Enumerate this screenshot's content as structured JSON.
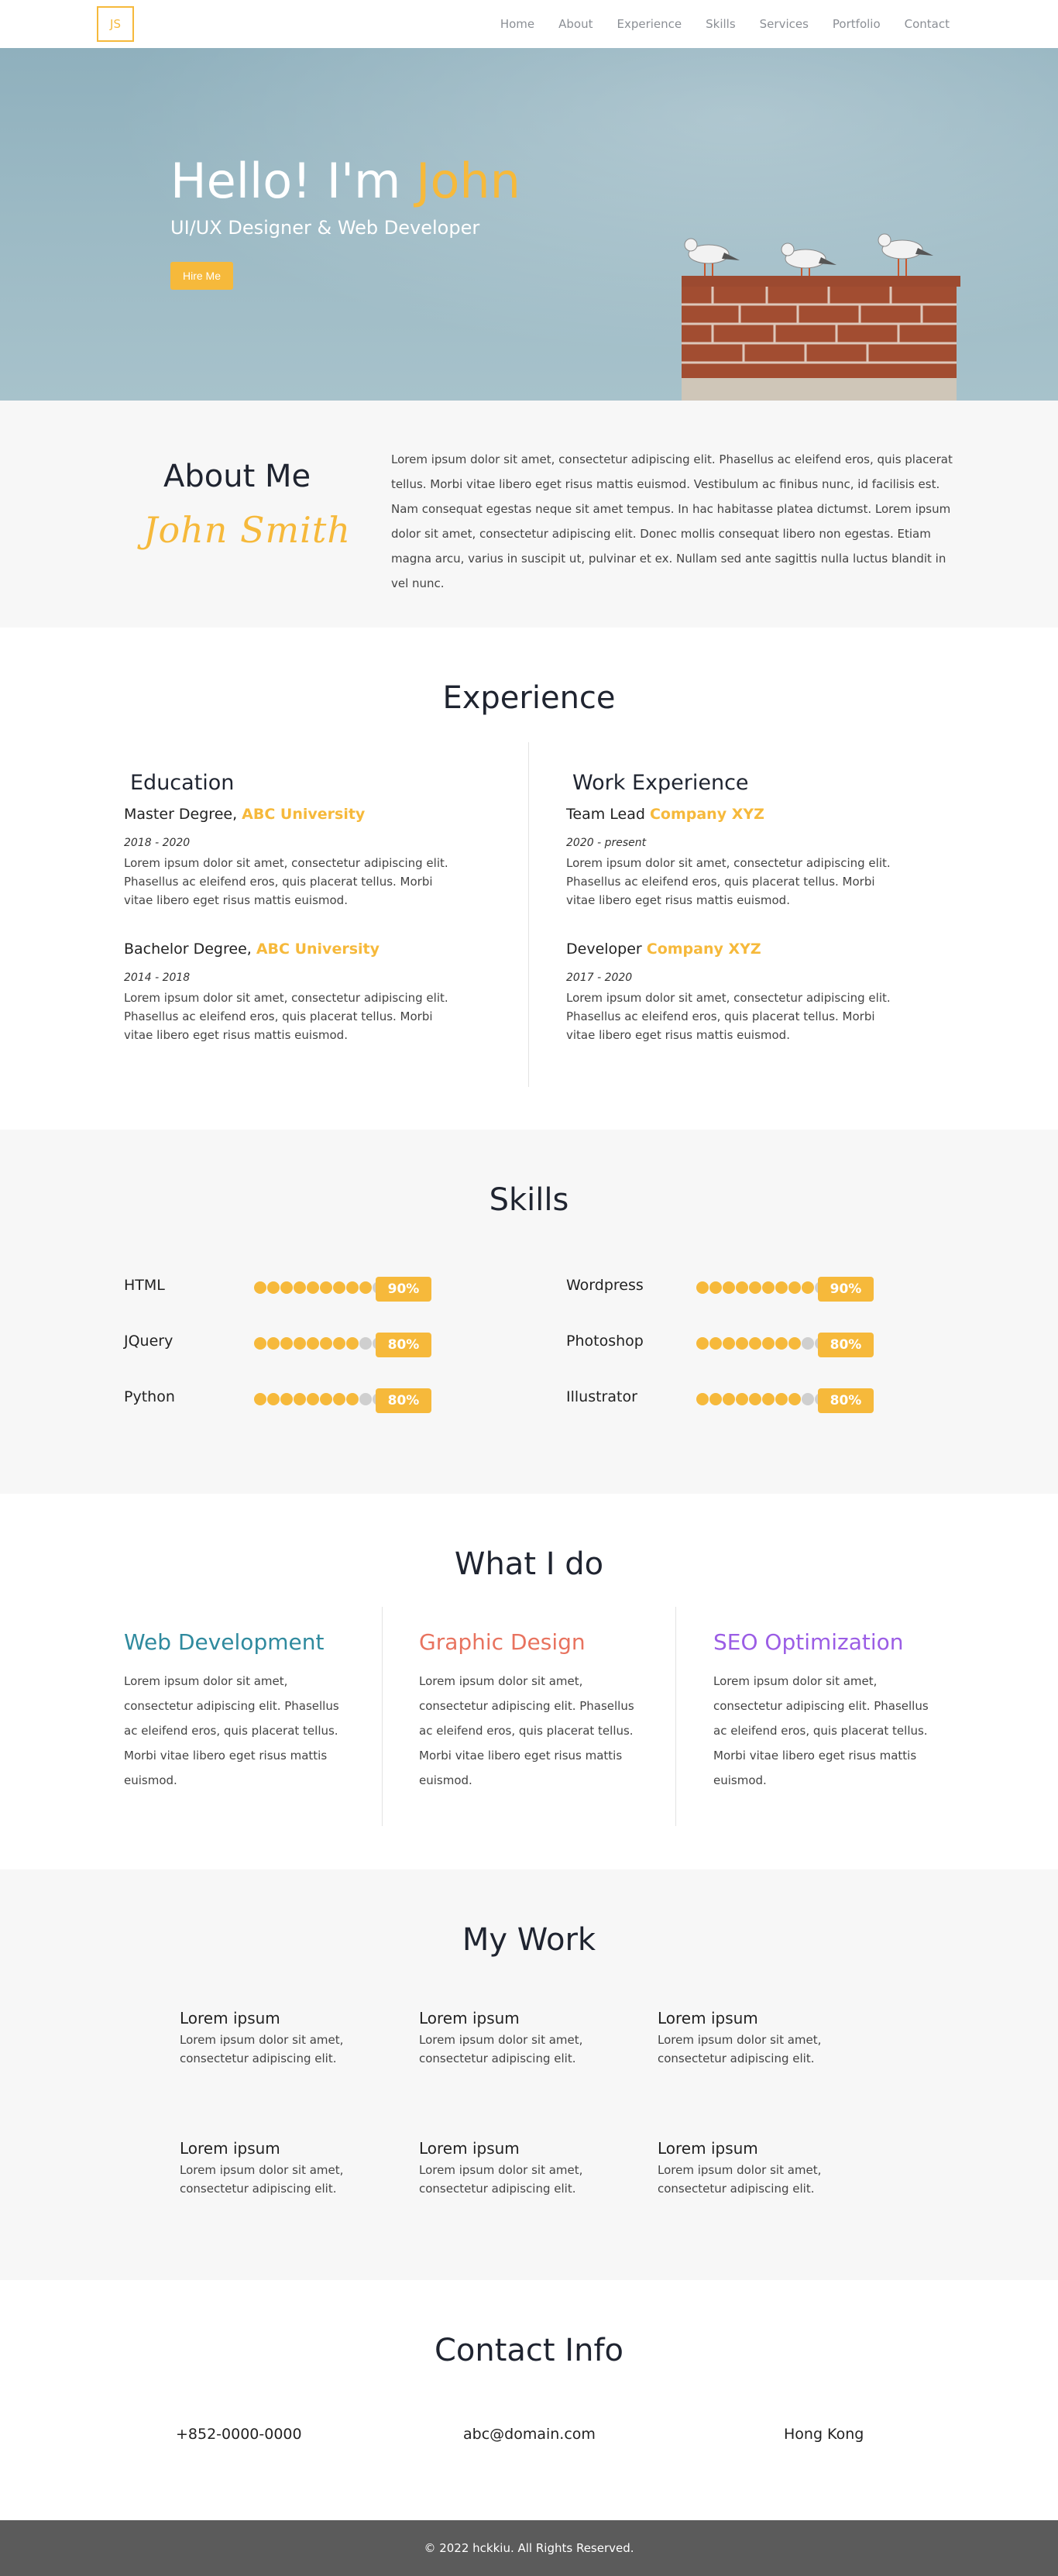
{
  "nav": {
    "logo": "JS",
    "items": [
      "Home",
      "About",
      "Experience",
      "Skills",
      "Services",
      "Portfolio",
      "Contact"
    ]
  },
  "hero": {
    "greeting": "Hello! I'm ",
    "name": "John",
    "subtitle": "UI/UX Designer & Web Developer",
    "cta": "Hire Me"
  },
  "about": {
    "title": "About Me",
    "signature": "John Smith",
    "text": "Lorem ipsum dolor sit amet, consectetur adipiscing elit. Phasellus ac eleifend eros, quis placerat tellus. Morbi vitae libero eget risus mattis euismod. Vestibulum ac finibus nunc, id facilisis est. Nam consequat egestas neque sit amet tempus. In hac habitasse platea dictumst. Lorem ipsum dolor sit amet, consectetur adipiscing elit. Donec mollis consequat libero non egestas. Etiam magna arcu, varius in suscipit ut, pulvinar et ex. Nullam sed ante sagittis nulla luctus blandit in vel nunc."
  },
  "experience": {
    "title": "Experience",
    "education": {
      "heading": "Education",
      "items": [
        {
          "role": "Master Degree, ",
          "org": "ABC University",
          "date": "2018 - 2020",
          "desc": "Lorem ipsum dolor sit amet, consectetur adipiscing elit. Phasellus ac eleifend eros, quis placerat tellus. Morbi vitae libero eget risus mattis euismod."
        },
        {
          "role": "Bachelor Degree, ",
          "org": "ABC University",
          "date": "2014 - 2018",
          "desc": "Lorem ipsum dolor sit amet, consectetur adipiscing elit. Phasellus ac eleifend eros, quis placerat tellus. Morbi vitae libero eget risus mattis euismod."
        }
      ]
    },
    "work": {
      "heading": "Work Experience",
      "items": [
        {
          "role": "Team Lead ",
          "org": "Company XYZ",
          "date": "2020 - present",
          "desc": "Lorem ipsum dolor sit amet, consectetur adipiscing elit. Phasellus ac eleifend eros, quis placerat tellus. Morbi vitae libero eget risus mattis euismod."
        },
        {
          "role": "Developer ",
          "org": "Company XYZ",
          "date": "2017 - 2020",
          "desc": "Lorem ipsum dolor sit amet, consectetur adipiscing elit. Phasellus ac eleifend eros, quis placerat tellus. Morbi vitae libero eget risus mattis euismod."
        }
      ]
    }
  },
  "skills": {
    "title": "Skills",
    "items": [
      {
        "name": "HTML",
        "percent": "90%",
        "level": 0.9
      },
      {
        "name": "Wordpress",
        "percent": "90%",
        "level": 0.9
      },
      {
        "name": "JQuery",
        "percent": "80%",
        "level": 0.8
      },
      {
        "name": "Photoshop",
        "percent": "80%",
        "level": 0.8
      },
      {
        "name": "Python",
        "percent": "80%",
        "level": 0.8
      },
      {
        "name": "Illustrator",
        "percent": "80%",
        "level": 0.8
      }
    ]
  },
  "services": {
    "title": "What I do",
    "items": [
      {
        "title": "Web Development",
        "color": "#2f8a9e",
        "desc": "Lorem ipsum dolor sit amet, consectetur adipiscing elit. Phasellus ac eleifend eros, quis placerat tellus. Morbi vitae libero eget risus mattis euismod."
      },
      {
        "title": "Graphic Design",
        "color": "#e8735f",
        "desc": "Lorem ipsum dolor sit amet, consectetur adipiscing elit. Phasellus ac eleifend eros, quis placerat tellus. Morbi vitae libero eget risus mattis euismod."
      },
      {
        "title": "SEO Optimization",
        "color": "#9b5de5",
        "desc": "Lorem ipsum dolor sit amet, consectetur adipiscing elit. Phasellus ac eleifend eros, quis placerat tellus. Morbi vitae libero eget risus mattis euismod."
      }
    ]
  },
  "portfolio": {
    "title": "My Work",
    "items": [
      {
        "title": "Lorem ipsum",
        "desc": "Lorem ipsum dolor sit amet, consectetur adipiscing elit."
      },
      {
        "title": "Lorem ipsum",
        "desc": "Lorem ipsum dolor sit amet, consectetur adipiscing elit."
      },
      {
        "title": "Lorem ipsum",
        "desc": "Lorem ipsum dolor sit amet, consectetur adipiscing elit."
      },
      {
        "title": "Lorem ipsum",
        "desc": "Lorem ipsum dolor sit amet, consectetur adipiscing elit."
      },
      {
        "title": "Lorem ipsum",
        "desc": "Lorem ipsum dolor sit amet, consectetur adipiscing elit."
      },
      {
        "title": "Lorem ipsum",
        "desc": "Lorem ipsum dolor sit amet, consectetur adipiscing elit."
      }
    ]
  },
  "contact": {
    "title": "Contact Info",
    "phone": "+852-0000-0000",
    "email": "abc@domain.com",
    "location": "Hong Kong"
  },
  "footer": {
    "text": "© 2022 hckkiu. All Rights Reserved."
  },
  "colors": {
    "accent": "#f6b93b",
    "footer": "#5b5b5b"
  }
}
